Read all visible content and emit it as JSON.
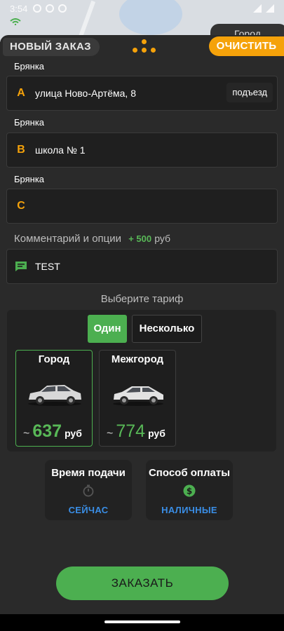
{
  "status_bar": {
    "time": "3:54"
  },
  "header": {
    "title": "НОВЫЙ ЗАКАЗ",
    "clear_label": "ОЧИСТИТЬ",
    "peek_tab_label": "Город",
    "accent_color": "#f5a20a"
  },
  "route": {
    "points": [
      {
        "city": "Брянка",
        "letter": "A",
        "address": "улица Ново-Артёма, 8",
        "entrance_label": "подъезд"
      },
      {
        "city": "Брянка",
        "letter": "B",
        "address": "школа № 1"
      },
      {
        "city": "Брянка",
        "letter": "C",
        "address": ""
      }
    ]
  },
  "comment": {
    "label": "Комментарий и опции",
    "extra_price": "+ 500",
    "extra_currency": "руб",
    "text": "TEST",
    "icon": "comment-icon"
  },
  "tariffs": {
    "heading": "Выберите тариф",
    "mode_one": "Один",
    "mode_many": "Несколько",
    "selected_mode": "Один",
    "items": [
      {
        "name": "Город",
        "approx": "~",
        "price": "637",
        "currency": "руб",
        "selected": true
      },
      {
        "name": "Межгород",
        "approx": "~",
        "price": "774",
        "currency": "руб",
        "selected": false
      }
    ],
    "selected_color": "#4caf50"
  },
  "pickup": {
    "title": "Время подачи",
    "value": "СЕЙЧАС",
    "icon": "stopwatch-icon"
  },
  "payment": {
    "title": "Способ оплаты",
    "value": "НАЛИЧНЫЕ",
    "icon": "dollar-icon"
  },
  "order_button": {
    "label": "ЗАКАЗАТЬ",
    "color": "#4caf50"
  }
}
